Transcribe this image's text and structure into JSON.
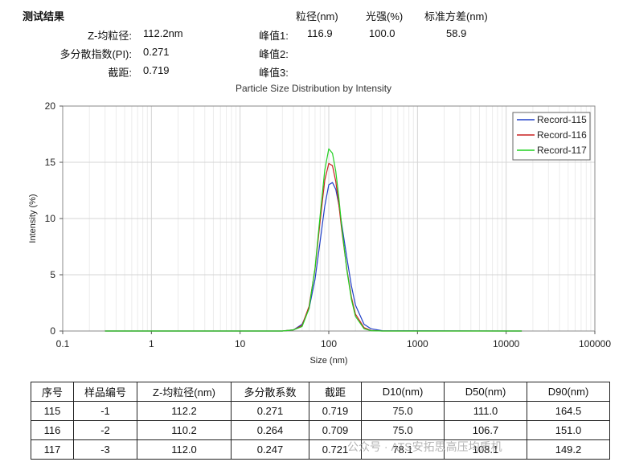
{
  "summary": {
    "heading": "测试结果",
    "z_avg_label": "Z-均粒径:",
    "z_avg_value": "112.2nm",
    "pdi_label": "多分散指数(PI):",
    "pdi_value": "0.271",
    "intercept_label": "截距:",
    "intercept_value": "0.719",
    "col_size": "粒径(nm)",
    "col_intensity": "光强(%)",
    "col_std": "标准方差(nm)",
    "peaks": [
      {
        "label": "峰值1:",
        "size": "116.9",
        "intensity": "100.0",
        "std": "58.9"
      },
      {
        "label": "峰值2:",
        "size": "",
        "intensity": "",
        "std": ""
      },
      {
        "label": "峰值3:",
        "size": "",
        "intensity": "",
        "std": ""
      }
    ]
  },
  "chart_data": {
    "type": "line",
    "title": "Particle Size Distribution by Intensity",
    "xlabel": "Size (nm)",
    "ylabel": "Intensity (%)",
    "x_scale": "log",
    "xlim": [
      0.1,
      100000
    ],
    "ylim": [
      0,
      20
    ],
    "x_ticks": [
      "0.1",
      "1",
      "10",
      "100",
      "1000",
      "10000",
      "100000"
    ],
    "y_ticks": [
      "0",
      "5",
      "10",
      "15",
      "20"
    ],
    "grid": true,
    "legend_position": "top-right",
    "x": [
      0.3,
      30,
      40,
      50,
      60,
      70,
      80,
      90,
      100,
      110,
      120,
      130,
      140,
      160,
      180,
      200,
      250,
      300,
      400,
      15000
    ],
    "series": [
      {
        "name": "Record-115",
        "color": "#2040c8",
        "values": [
          0,
          0,
          0.1,
          0.6,
          2.0,
          4.6,
          8.0,
          11.1,
          13.0,
          13.2,
          12.6,
          11.2,
          9.5,
          6.5,
          4.0,
          2.3,
          0.6,
          0.2,
          0.03,
          0
        ]
      },
      {
        "name": "Record-116",
        "color": "#c82020",
        "values": [
          0,
          0,
          0.1,
          0.5,
          2.2,
          5.5,
          9.8,
          13.4,
          14.9,
          14.7,
          13.3,
          11.2,
          9.0,
          5.5,
          3.0,
          1.5,
          0.3,
          0.05,
          0,
          0
        ]
      },
      {
        "name": "Record-117",
        "color": "#20d020",
        "values": [
          0,
          0,
          0.1,
          0.4,
          2.0,
          5.6,
          10.3,
          14.3,
          16.2,
          15.8,
          14.2,
          11.8,
          9.3,
          5.4,
          2.8,
          1.3,
          0.2,
          0.03,
          0,
          0
        ]
      }
    ]
  },
  "table": {
    "headers": [
      "序号",
      "样品编号",
      "Z-均粒径(nm)",
      "多分散系数",
      "截距",
      "D10(nm)",
      "D50(nm)",
      "D90(nm)"
    ],
    "rows": [
      [
        "115",
        "-1",
        "112.2",
        "0.271",
        "0.719",
        "75.0",
        "111.0",
        "164.5"
      ],
      [
        "116",
        "-2",
        "110.2",
        "0.264",
        "0.709",
        "75.0",
        "106.7",
        "151.0"
      ],
      [
        "117",
        "-3",
        "112.0",
        "0.247",
        "0.721",
        "78.1",
        "108.1",
        "149.2"
      ]
    ]
  },
  "watermark": "公众号 · ATS安拓思高压均质机"
}
